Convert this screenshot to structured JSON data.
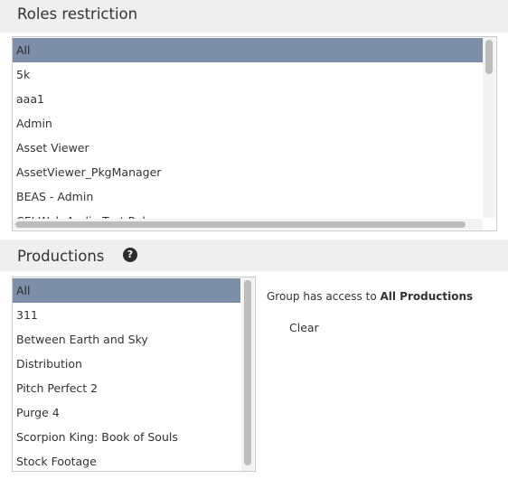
{
  "roles": {
    "title": "Roles restriction",
    "items": [
      "All",
      "5k",
      "aaa1",
      "Admin",
      "Asset Viewer",
      "AssetViewer_PkgManager",
      "BEAS - Admin",
      "CEI Web Audio Test Role"
    ],
    "selected": "All"
  },
  "productions": {
    "title": "Productions",
    "help_icon": "question-circle-icon",
    "help_glyph": "?",
    "items": [
      "All",
      "311",
      "Between Earth and Sky",
      "Distribution",
      "Pitch Perfect 2",
      "Purge 4",
      "Scorpion King: Book of Souls",
      "Stock Footage"
    ],
    "selected": "All",
    "access_prefix": "Group has access to ",
    "access_value": "All Productions",
    "clear_label": "Clear"
  },
  "colors": {
    "selected_row": "#7d8fa8",
    "header_bg": "#efefef",
    "help_icon_bg": "#2b2b2b"
  }
}
